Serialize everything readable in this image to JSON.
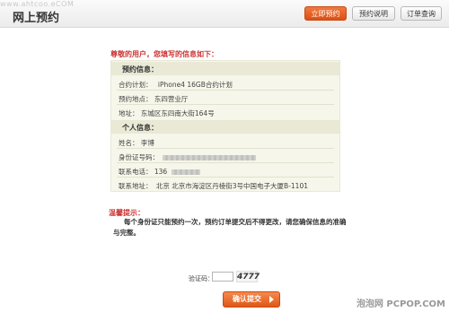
{
  "header": {
    "watermark_text": "www.ahtcoo.eCOM",
    "title": "网上预约",
    "buttons": {
      "reserve_now": "立即预约",
      "reserve_info": "预约说明",
      "order_query": "订单查询"
    }
  },
  "greeting": "尊敬的用户，您填写的信息如下：",
  "reservation": {
    "section_title": "预约信息：",
    "plan": {
      "label": "合约计划：",
      "value": "iPhone4 16GB合约计划"
    },
    "location": {
      "label": "预约地点：",
      "value": "东四营业厅"
    },
    "address": {
      "label": "地址：",
      "value": "东城区东四南大街164号"
    }
  },
  "personal": {
    "section_title": "个人信息：",
    "name": {
      "label": "姓名：",
      "value": "李博"
    },
    "id_number": {
      "label": "身份证号码：",
      "value": ""
    },
    "phone": {
      "label": "联系电话：",
      "value": "136"
    },
    "contact_address": {
      "label": "联系地址：",
      "value": "北京 北京市海淀区丹棱街3号中国电子大厦B-1101"
    }
  },
  "notice": {
    "title": "温馨提示：",
    "text": "每个身份证只能预约一次，预约订单提交后不得更改，请您确保信息的准确与完整。"
  },
  "captcha": {
    "label": "验证码：",
    "input_value": "",
    "image_text": "4777"
  },
  "confirm_button": "确认提交",
  "footer_watermark": "泡泡网 PCPOP.COM",
  "colors": {
    "accent": "#e05716",
    "highlight_text": "#cc3333",
    "info_bg": "#f6f6ea"
  }
}
